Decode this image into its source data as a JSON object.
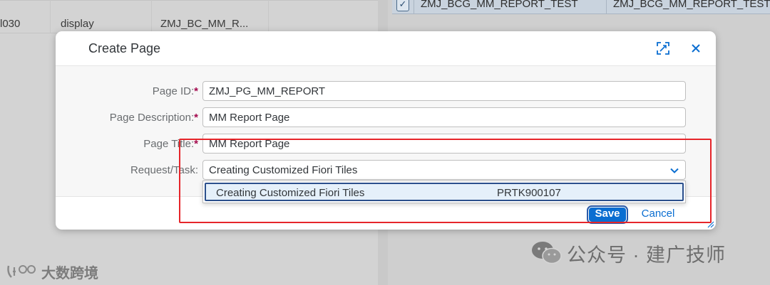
{
  "background": {
    "left_row": {
      "col1": "l030",
      "col2": "display",
      "col3": "ZMJ_BC_MM_R..."
    },
    "right_row": {
      "checkbox_checked": true,
      "col1": "ZMJ_BCG_MM_REPORT_TEST",
      "col2": "ZMJ_BCG_MM_REPORT_TEST"
    }
  },
  "dialog": {
    "title": "Create Page",
    "header_icons": [
      "expand-icon",
      "close-icon"
    ],
    "fields": {
      "page_id": {
        "label": "Page ID:",
        "required_mark": "*",
        "value": "ZMJ_PG_MM_REPORT"
      },
      "page_description": {
        "label": "Page Description:",
        "required_mark": "*",
        "value": "MM Report Page"
      },
      "page_title": {
        "label": "Page Title:",
        "required_mark": "*",
        "value": "MM Report Page"
      },
      "request_task": {
        "label": "Request/Task:",
        "value": "Creating Customized Fiori Tiles"
      }
    },
    "dropdown": {
      "options": [
        {
          "description": "Creating Customized Fiori Tiles",
          "request": "PRTK900107",
          "selected": true
        }
      ]
    },
    "buttons": {
      "save": "Save",
      "cancel": "Cancel"
    }
  },
  "colors": {
    "accent": "#0a6ed1",
    "required": "#a3094d",
    "highlight": "#e6252a"
  },
  "watermarks": {
    "right": "公众号 · 建广技师",
    "left": "大数跨境"
  }
}
